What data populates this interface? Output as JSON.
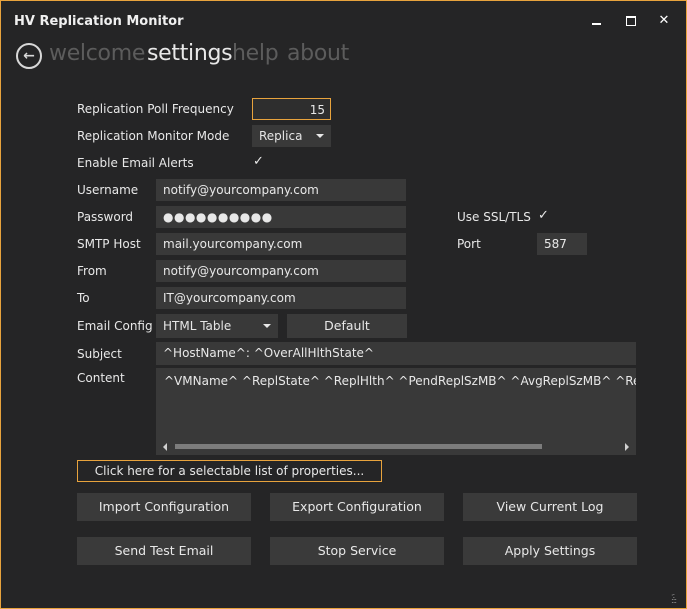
{
  "window": {
    "title": "HV Replication Monitor"
  },
  "nav": {
    "welcome": "welcome",
    "settings": "settings",
    "help": "help",
    "about": "about"
  },
  "settings": {
    "poll_frequency_label": "Replication Poll Frequency",
    "poll_frequency_value": "15",
    "monitor_mode_label": "Replication Monitor Mode",
    "monitor_mode_value": "Replica",
    "email_alerts_label": "Enable Email Alerts",
    "email_alerts_checked": true,
    "username_label": "Username",
    "username_value": "notify@yourcompany.com",
    "password_label": "Password",
    "password_value": "●●●●●●●●●●",
    "ssl_label": "Use SSL/TLS",
    "ssl_checked": true,
    "smtp_host_label": "SMTP Host",
    "smtp_host_value": "mail.yourcompany.com",
    "port_label": "Port",
    "port_value": "587",
    "from_label": "From",
    "from_value": "notify@yourcompany.com",
    "to_label": "To",
    "to_value": "IT@yourcompany.com",
    "email_config_label": "Email Config",
    "email_config_value": "HTML Table",
    "default_button": "Default",
    "subject_label": "Subject",
    "subject_value": "^HostName^: ^OverAllHlthState^",
    "content_label": "Content",
    "content_value": "^VMName^  ^ReplState^  ^ReplHlth^  ^PendReplSzMB^  ^AvgReplSzMB^  ^ReplI"
  },
  "properties_link": "Click here for a selectable list of properties...",
  "buttons": {
    "import_config": "Import Configuration",
    "export_config": "Export Configuration",
    "view_log": "View Current Log",
    "send_test": "Send Test Email",
    "stop_service": "Stop Service",
    "apply_settings": "Apply Settings"
  },
  "icons": {
    "back": "back-arrow-icon",
    "check": "checkmark-icon"
  },
  "colors": {
    "accent": "#e8a33d",
    "background": "#252526",
    "field": "#393939"
  }
}
